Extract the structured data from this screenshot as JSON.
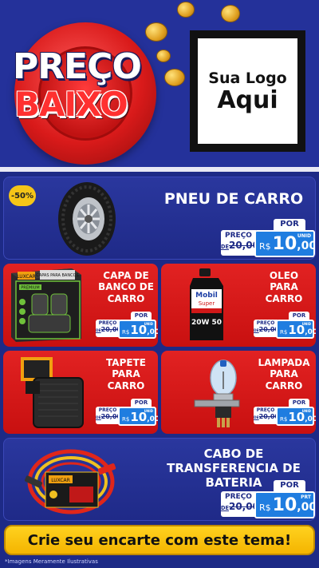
{
  "header": {
    "preco": "PREÇO",
    "baixo": "BAIXO",
    "logo_line1": "Sua Logo",
    "logo_line2": "Aqui"
  },
  "products": [
    {
      "name": "PNEU DE CARRO",
      "discount": "-50%",
      "por": "POR",
      "preco_label": "PREÇO",
      "old_de": "DE",
      "old_price": "20,00",
      "currency": "R$",
      "price_int": "10",
      "price_dec": ",00",
      "unit": "UNID"
    },
    {
      "name": "CAPA DE BANCO DE CARRO",
      "por": "POR",
      "preco_label": "PREÇO",
      "old_de": "DE",
      "old_price": "20,00",
      "currency": "R$",
      "price_int": "10",
      "price_dec": ",00",
      "unit": "UNID",
      "box_text": "CAPAS PARA BANCOS",
      "box_sub": "PREMIUM",
      "box_brand": "LUXCAR"
    },
    {
      "name": "OLEO PARA CARRO",
      "por": "POR",
      "preco_label": "PREÇO",
      "old_de": "DE",
      "old_price": "20,00",
      "currency": "R$",
      "price_int": "10",
      "price_dec": ",00",
      "unit": "UNID",
      "bottle_brand": "Mobil",
      "bottle_sub": "Super",
      "bottle_grade": "20W 50"
    },
    {
      "name": "TAPETE PARA CARRO",
      "por": "POR",
      "preco_label": "PREÇO",
      "old_de": "DE",
      "old_price": "20,00",
      "currency": "R$",
      "price_int": "10",
      "price_dec": ",00",
      "unit": "UNID"
    },
    {
      "name": "LAMPADA PARA CARRO",
      "por": "POR",
      "preco_label": "PREÇO",
      "old_de": "DE",
      "old_price": "20,00",
      "currency": "R$",
      "price_int": "10",
      "price_dec": ",00",
      "unit": "UNID"
    },
    {
      "name": "CABO DE TRANSFERENCIA DE BATERIA",
      "por": "POR",
      "preco_label": "PREÇO",
      "old_de": "DE",
      "old_price": "20,00",
      "currency": "R$",
      "price_int": "10",
      "price_dec": ",00",
      "unit": "PRT",
      "cable_brand": "LUXCAR"
    }
  ],
  "cta": "Crie seu encarte com este tema!",
  "disclaimer": "*Imagens Meramente Ilustrativas",
  "colors": {
    "navy": "#24319a",
    "red": "#d91a1a",
    "price_blue": "#1f7de0",
    "yellow": "#f5c518"
  }
}
